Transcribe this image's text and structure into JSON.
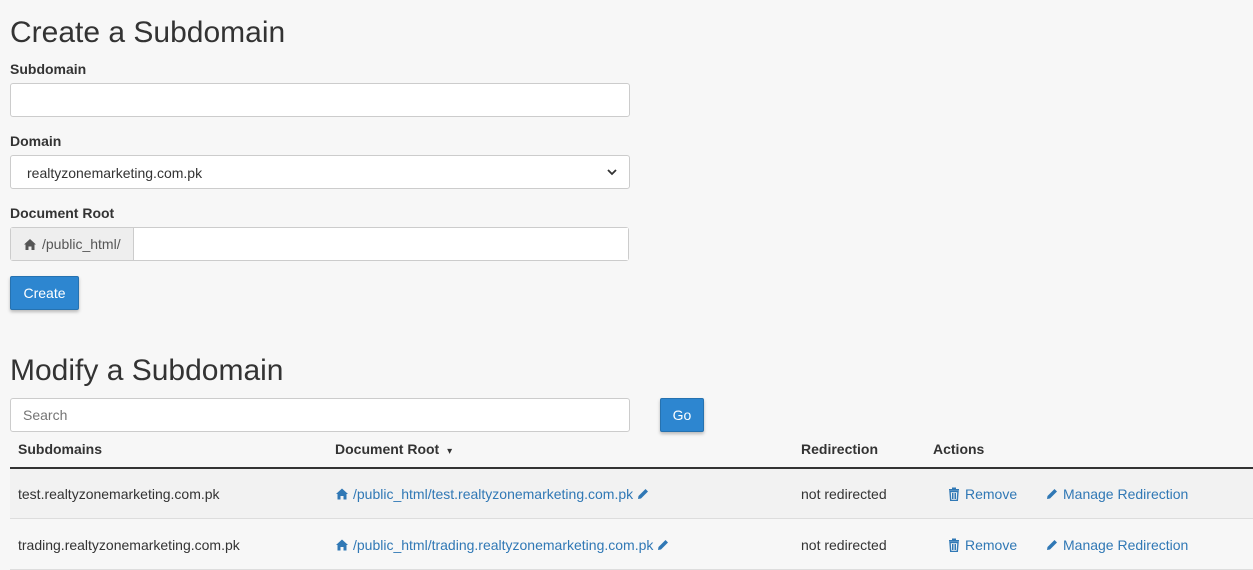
{
  "create": {
    "title": "Create a Subdomain",
    "subdomain_label": "Subdomain",
    "subdomain_value": "",
    "domain_label": "Domain",
    "domain_selected": "realtyzonemarketing.com.pk",
    "docroot_label": "Document Root",
    "docroot_prefix": "/public_html/",
    "docroot_value": "",
    "create_button": "Create"
  },
  "modify": {
    "title": "Modify a Subdomain",
    "search_placeholder": "Search",
    "go_button": "Go",
    "columns": {
      "subdomains": "Subdomains",
      "docroot": "Document Root",
      "sort_indicator": "▾",
      "redirection": "Redirection",
      "actions": "Actions"
    },
    "rows": [
      {
        "subdomain": "test.realtyzonemarketing.com.pk",
        "docroot": "/public_html/test.realtyzonemarketing.com.pk",
        "redirection": "not redirected",
        "remove": "Remove",
        "manage": "Manage Redirection"
      },
      {
        "subdomain": "trading.realtyzonemarketing.com.pk",
        "docroot": "/public_html/trading.realtyzonemarketing.com.pk",
        "redirection": "not redirected",
        "remove": "Remove",
        "manage": "Manage Redirection"
      }
    ]
  },
  "icons": {
    "home": "home-icon",
    "pencil": "pencil-icon",
    "trash": "trash-icon",
    "chevron": "chevron-down-icon"
  },
  "colors": {
    "primary": "#2d86d0",
    "link": "#3078b5",
    "background": "#f7f7f7"
  }
}
